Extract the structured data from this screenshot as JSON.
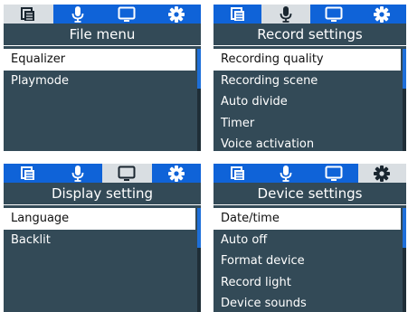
{
  "tab_icons": [
    "folder-icon",
    "microphone-icon",
    "monitor-icon",
    "gear-icon"
  ],
  "screens": [
    {
      "title": "File menu",
      "active_tab": 0,
      "items": [
        "Equalizer",
        "Playmode"
      ],
      "selected": 0
    },
    {
      "title": "Record settings",
      "active_tab": 1,
      "items": [
        "Recording quality",
        "Recording scene",
        "Auto divide",
        "Timer",
        "Voice activation"
      ],
      "selected": 0
    },
    {
      "title": "Display setting",
      "active_tab": 2,
      "items": [
        "Language",
        "Backlit"
      ],
      "selected": 0
    },
    {
      "title": "Device settings",
      "active_tab": 3,
      "items": [
        "Date/time",
        "Auto off",
        "Format device",
        "Record light",
        "Device sounds"
      ],
      "selected": 0
    }
  ]
}
